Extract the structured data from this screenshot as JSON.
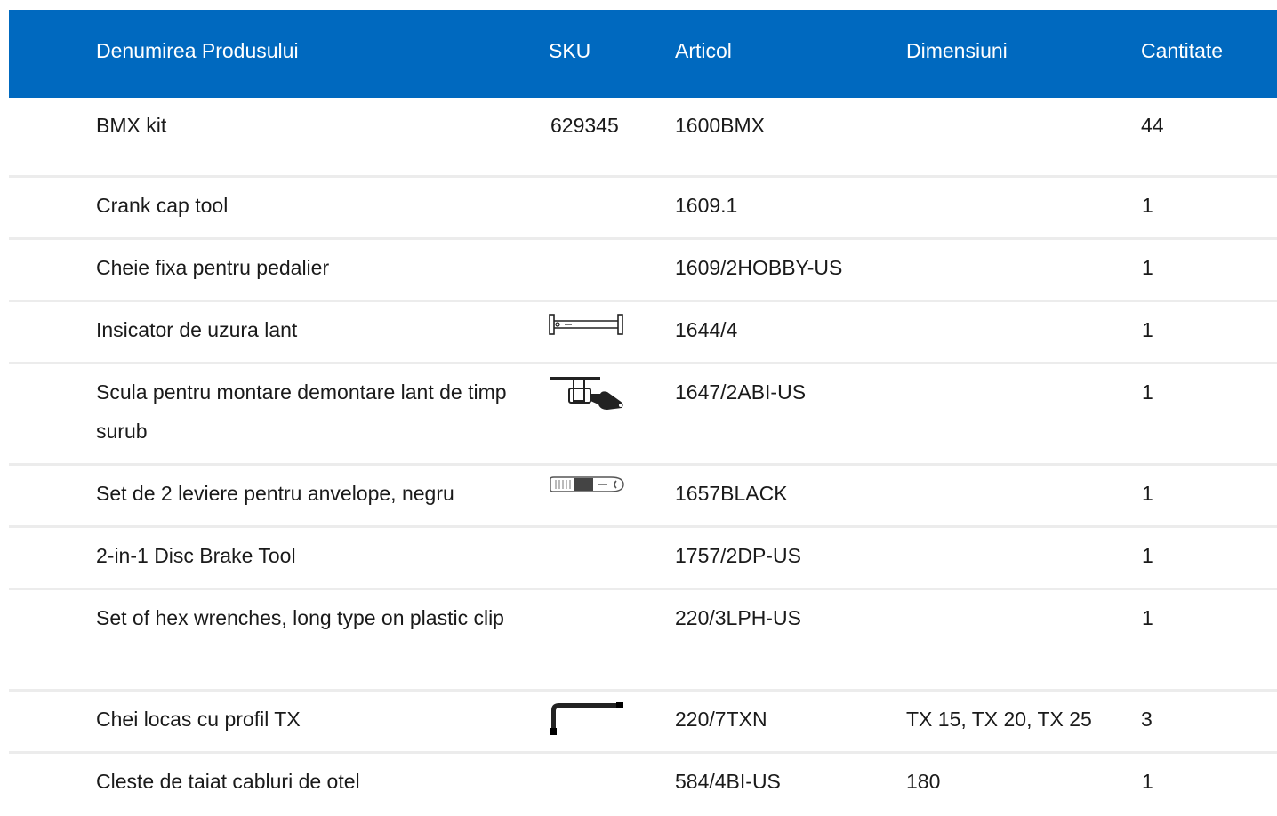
{
  "table": {
    "headers": {
      "name": "Denumirea Produsului",
      "sku": "SKU",
      "article": "Articol",
      "dimensions": "Dimensiuni",
      "quantity": "Cantitate"
    },
    "rows": [
      {
        "name": "BMX kit",
        "sku": "629345",
        "image": "",
        "article": "1600BMX",
        "dimensions": "",
        "quantity": "44"
      },
      {
        "name": "Crank cap tool",
        "sku": "",
        "image": "",
        "article": "1609.1",
        "dimensions": "",
        "quantity": "1"
      },
      {
        "name": "Cheie fixa pentru pedalier",
        "sku": "",
        "image": "",
        "article": "1609/2HOBBY-US",
        "dimensions": "",
        "quantity": "1"
      },
      {
        "name": "Insicator de uzura lant",
        "sku": "",
        "image": "chain-wear-indicator-icon",
        "article": "1644/4",
        "dimensions": "",
        "quantity": "1"
      },
      {
        "name": "Scula pentru montare demontare lant de timp surub",
        "sku": "",
        "image": "chain-tool-icon",
        "article": "1647/2ABI-US",
        "dimensions": "",
        "quantity": "1"
      },
      {
        "name": "Set de 2 leviere pentru anvelope, negru",
        "sku": "",
        "image": "tire-lever-icon",
        "article": "1657BLACK",
        "dimensions": "",
        "quantity": "1"
      },
      {
        "name": "2-in-1 Disc Brake Tool",
        "sku": "",
        "image": "",
        "article": "1757/2DP-US",
        "dimensions": "",
        "quantity": "1"
      },
      {
        "name": "Set of hex wrenches, long type on plastic clip",
        "sku": "",
        "image": "",
        "article": "220/3LPH-US",
        "dimensions": "",
        "quantity": "1"
      },
      {
        "name": "Chei locas cu profil TX",
        "sku": "",
        "image": "torx-key-icon",
        "article": "220/7TXN",
        "dimensions": "TX 15, TX 20, TX 25",
        "quantity": "3"
      },
      {
        "name": "Cleste de taiat cabluri de otel",
        "sku": "",
        "image": "",
        "article": "584/4BI-US",
        "dimensions": "180",
        "quantity": "1"
      }
    ]
  },
  "colors": {
    "header_background": "#0069bf",
    "header_text": "#ffffff",
    "row_divider": "#ececec",
    "body_text": "#1a1a1a"
  }
}
